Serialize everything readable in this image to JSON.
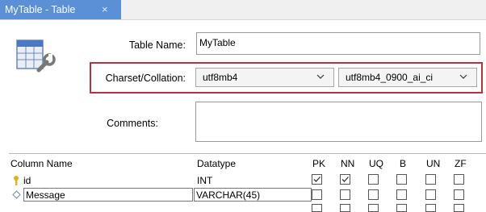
{
  "tab": {
    "title": "MyTable - Table",
    "close": "×"
  },
  "form": {
    "table_name_label": "Table Name:",
    "table_name_value": "MyTable",
    "charset_label": "Charset/Collation:",
    "charset_value": "utf8mb4",
    "collation_value": "utf8mb4_0900_ai_ci",
    "comments_label": "Comments:",
    "comments_value": ""
  },
  "columns": {
    "headers": [
      "Column Name",
      "Datatype",
      "PK",
      "NN",
      "UQ",
      "B",
      "UN",
      "ZF"
    ],
    "rows": [
      {
        "name": "id",
        "datatype": "INT",
        "icon": "key-icon",
        "checks": [
          true,
          true,
          false,
          false,
          false,
          false
        ]
      },
      {
        "name": "Message",
        "datatype": "VARCHAR(45)",
        "icon": "diamond-icon",
        "checks": [
          false,
          false,
          false,
          false,
          false,
          false
        ]
      }
    ]
  },
  "colors": {
    "tab_active": "#5b8fd6",
    "highlight_border": "#b1353c",
    "key_icon": "#e0b020"
  }
}
